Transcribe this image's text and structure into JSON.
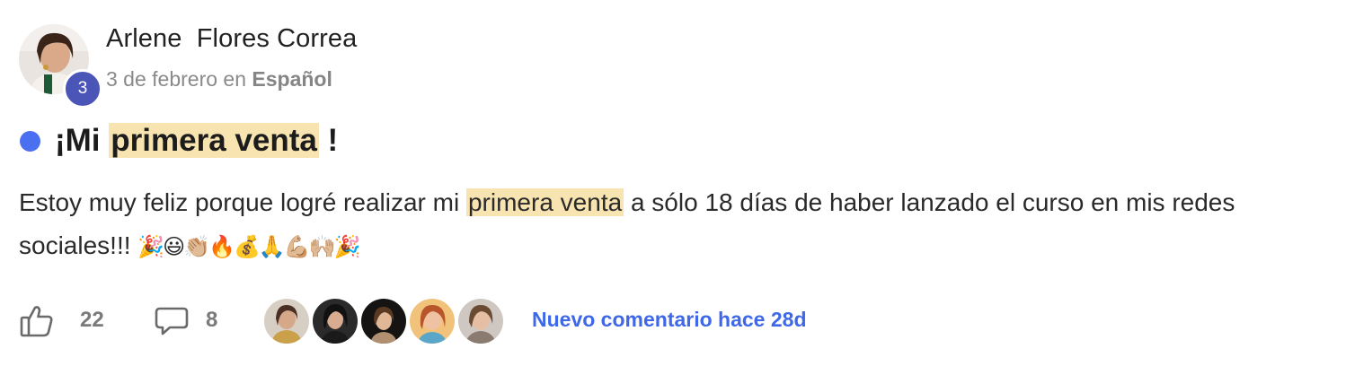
{
  "author": {
    "name": "Arlene  Flores Correa",
    "level": "3",
    "date": "3 de febrero",
    "in_word": "en",
    "category": "Español"
  },
  "post": {
    "title_prefix": "¡Mi ",
    "title_highlight": "primera venta",
    "title_suffix": " !",
    "body_prefix": "Estoy muy feliz porque logré realizar mi ",
    "body_highlight": "primera venta",
    "body_suffix": " a sólo 18 días de haber lanzado el curso en mis redes sociales!!! ",
    "body_emojis": "🎉😃👏🏼🔥💰🙏💪🏼🙌🏼🎉"
  },
  "footer": {
    "like_count": "22",
    "comment_count": "8",
    "new_comment_text": "Nuevo comentario hace 28d"
  },
  "colors": {
    "accent_blue": "#3f68e8",
    "unread_dot": "#4a6ff0",
    "level_badge": "#4b55b8",
    "highlight": "#f8e4b0"
  },
  "icons": {
    "like": "thumbs-up-icon",
    "comment": "speech-bubble-icon"
  }
}
